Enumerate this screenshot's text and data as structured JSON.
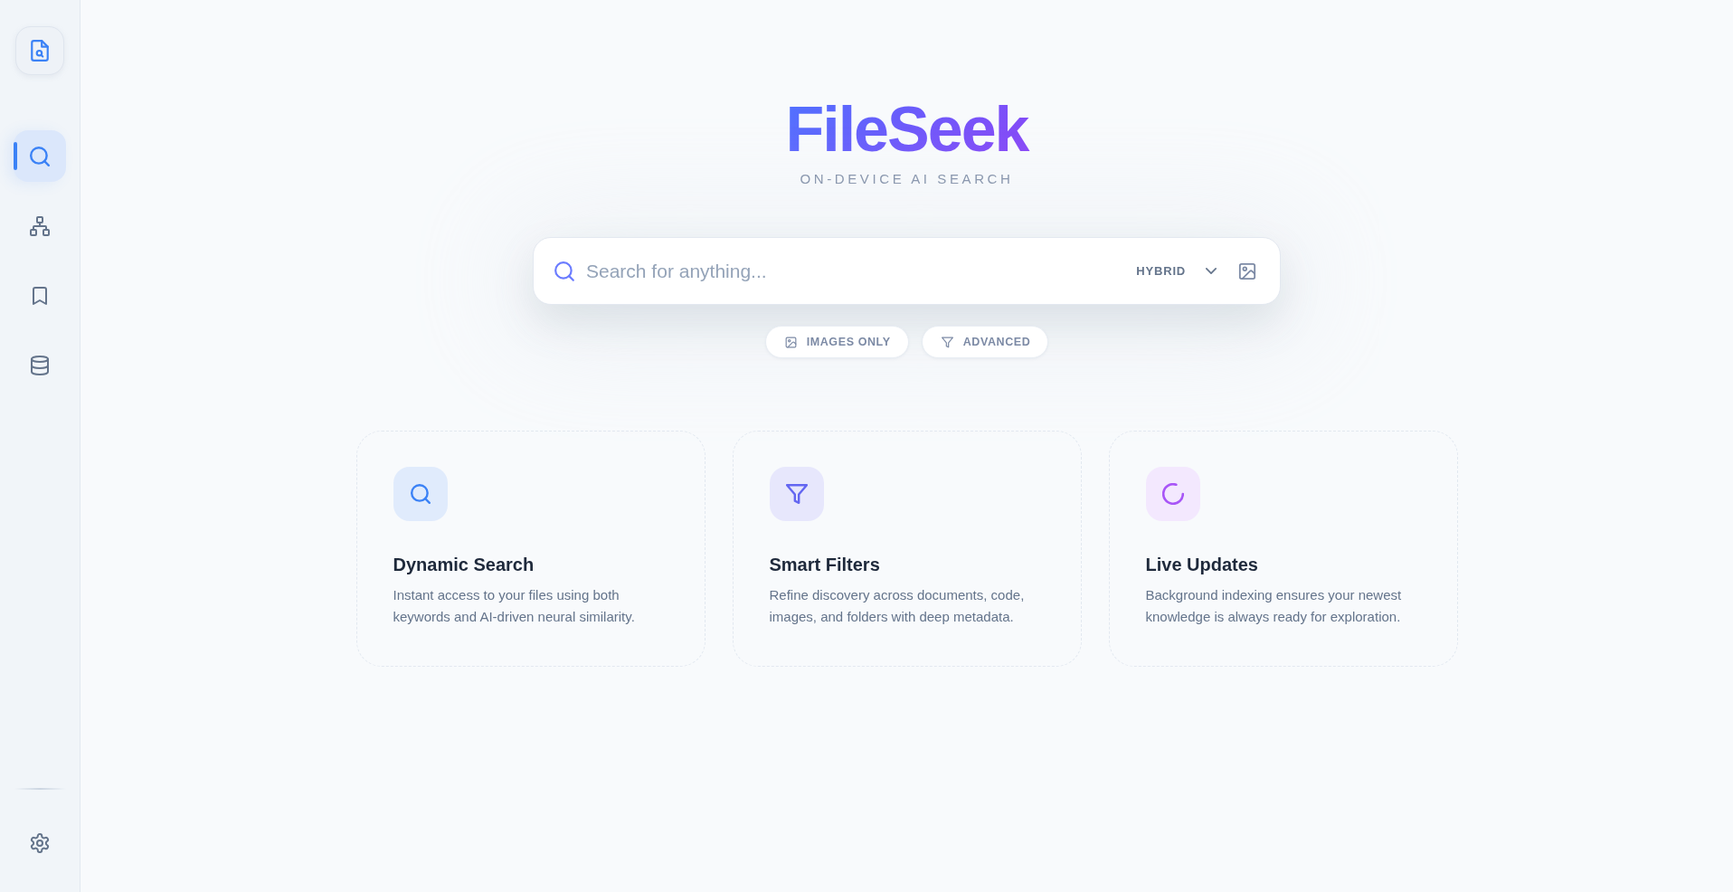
{
  "sidebar": {
    "nav_items": [
      {
        "selected": true
      },
      {
        "selected": false
      },
      {
        "selected": false
      },
      {
        "selected": false
      }
    ]
  },
  "brand": {
    "title": "FileSeek",
    "subtitle": "ON-DEVICE AI SEARCH"
  },
  "search": {
    "placeholder": "Search for anything...",
    "mode": "HYBRID"
  },
  "filter_chips": [
    {
      "label": "IMAGES ONLY"
    },
    {
      "label": "ADVANCED"
    }
  ],
  "features": [
    {
      "title": "Dynamic Search",
      "description": "Instant access to your files using both keywords and AI-driven neural similarity."
    },
    {
      "title": "Smart Filters",
      "description": "Refine discovery across documents, code, images, and folders with deep metadata."
    },
    {
      "title": "Live Updates",
      "description": "Background indexing ensures your newest knowledge is always ready for exploration."
    }
  ]
}
